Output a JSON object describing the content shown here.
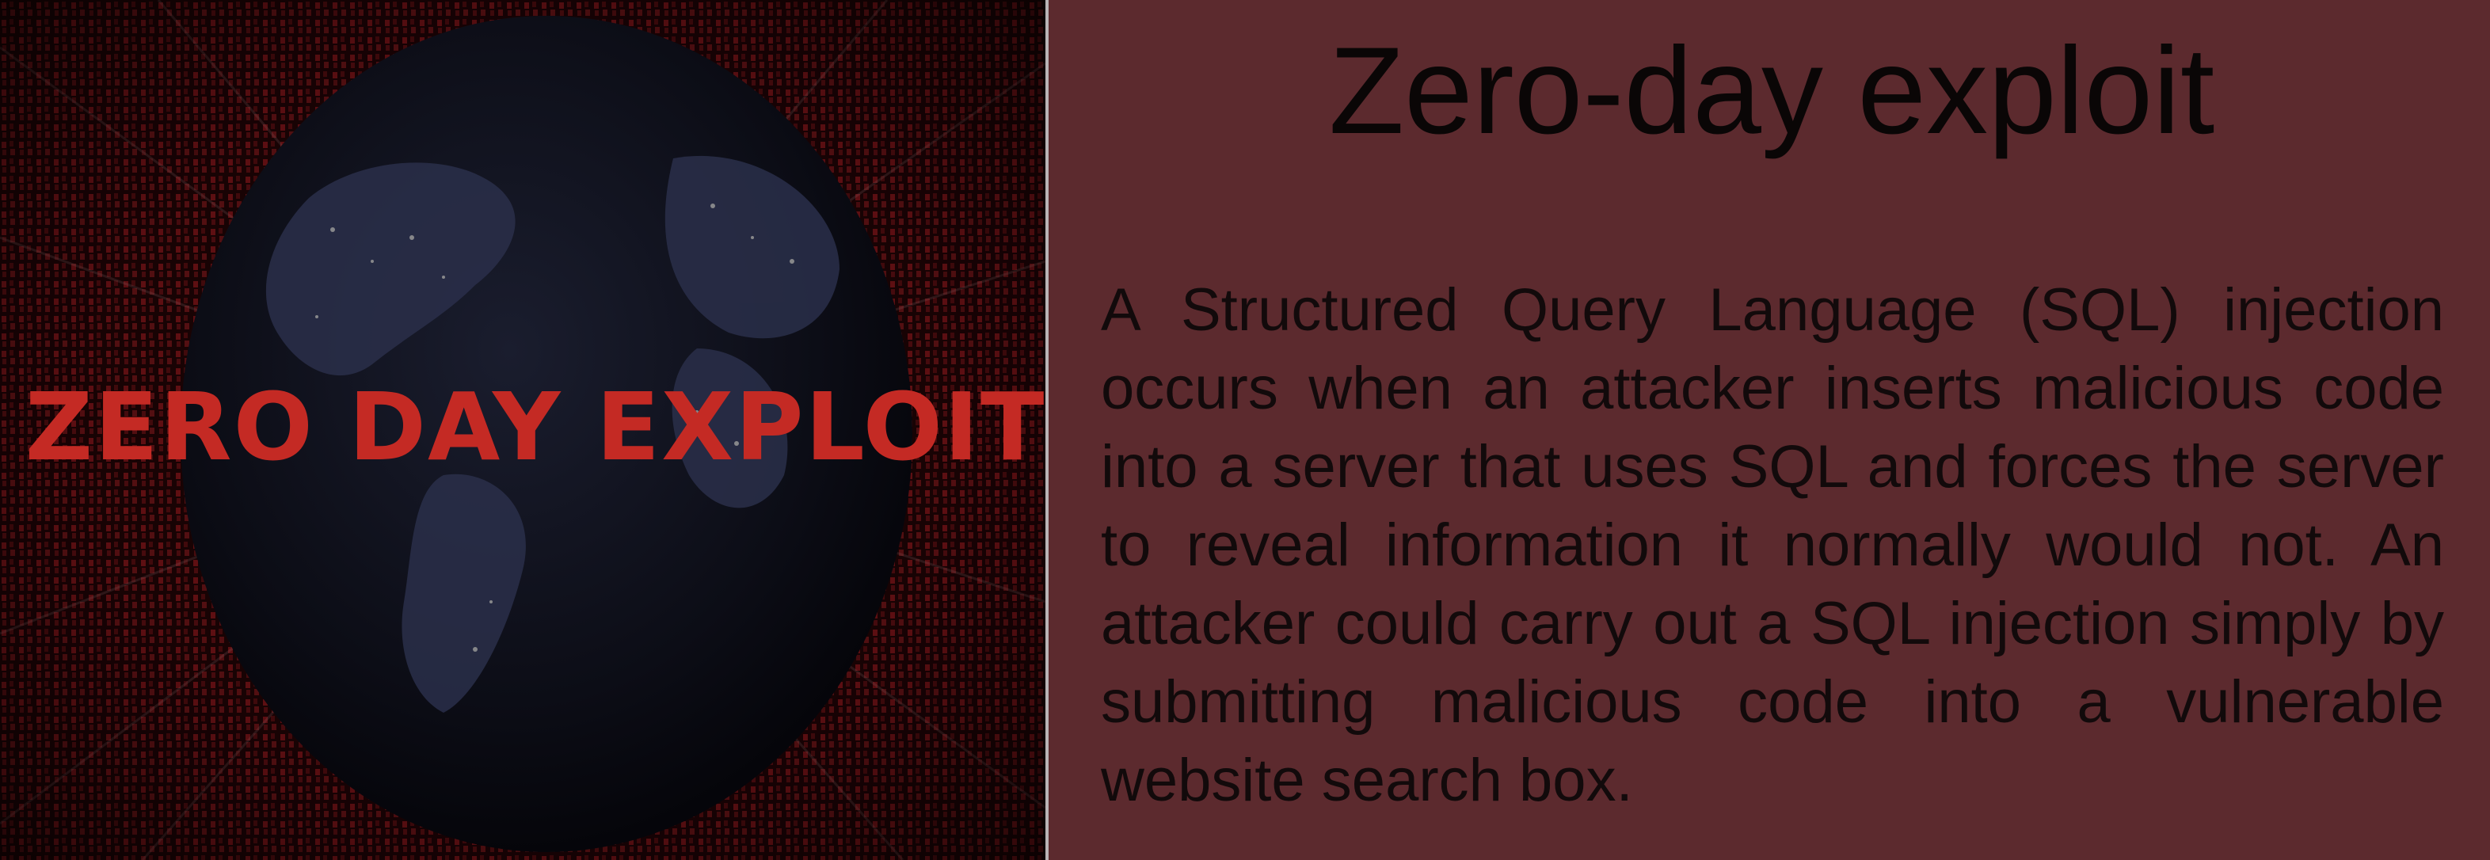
{
  "picture": {
    "caption": "ZERO DAY EXPLOIT"
  },
  "slide": {
    "title": "Zero-day exploit",
    "body": "A Structured Query Language (SQL) injection occurs when an attacker inserts malicious code into a server that uses SQL and forces the server to reveal information it normally would not. An attacker could carry out a SQL injection simply by submitting malicious code into a vulnerable website search box."
  },
  "colors": {
    "background": "#5c2a2e",
    "caption_red": "#c42a24",
    "text": "#120a0b"
  }
}
